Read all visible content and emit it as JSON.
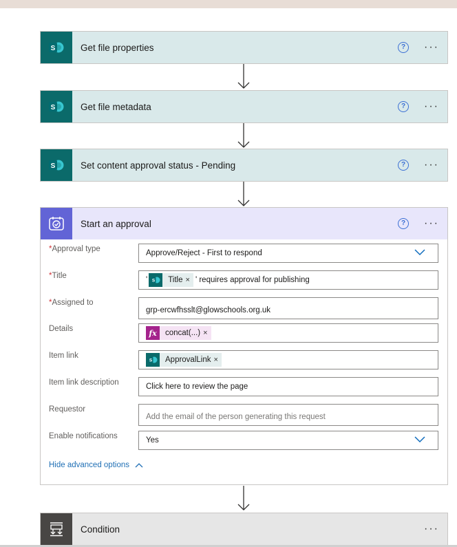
{
  "actions": {
    "get_file_properties": {
      "title": "Get file properties",
      "help": "?",
      "more": "···"
    },
    "get_file_metadata": {
      "title": "Get file metadata",
      "help": "?",
      "more": "···"
    },
    "set_approval_status": {
      "title": "Set content approval status - Pending",
      "help": "?",
      "more": "···"
    }
  },
  "approval": {
    "title": "Start an approval",
    "help": "?",
    "more": "···",
    "fields": {
      "approval_type": {
        "label": "Approval type",
        "required": "*",
        "value": "Approve/Reject - First to respond"
      },
      "title": {
        "label": "Title",
        "required": "*",
        "prefix": "'",
        "token": "Title",
        "suffix": "' requires approval for publishing"
      },
      "assigned_to": {
        "label": "Assigned to",
        "required": "*",
        "value": "grp-ercwfhsslt@glowschools.org.uk"
      },
      "details": {
        "label": "Details",
        "fx": "fx",
        "token": "concat(...)"
      },
      "item_link": {
        "label": "Item link",
        "token": "ApprovalLink"
      },
      "item_link_description": {
        "label": "Item link description",
        "value": "Click here to review the page"
      },
      "requestor": {
        "label": "Requestor",
        "placeholder": "Add the email of the person generating this request"
      },
      "enable_notifications": {
        "label": "Enable notifications",
        "value": "Yes"
      }
    },
    "hide_advanced": "Hide advanced options",
    "token_remove": "×"
  },
  "condition": {
    "title": "Condition",
    "more": "···"
  },
  "colors": {
    "sharepoint": "#0b6a6a",
    "approvals": "#6264d6",
    "condition": "#484644",
    "link": "#1f6fb5",
    "required": "#d13438"
  },
  "icons": [
    "sharepoint-icon",
    "approvals-icon",
    "condition-icon",
    "help-icon",
    "more-icon",
    "chevron-down-icon",
    "chevron-up-icon",
    "arrow-down-icon",
    "expression-icon",
    "remove-token-icon"
  ]
}
